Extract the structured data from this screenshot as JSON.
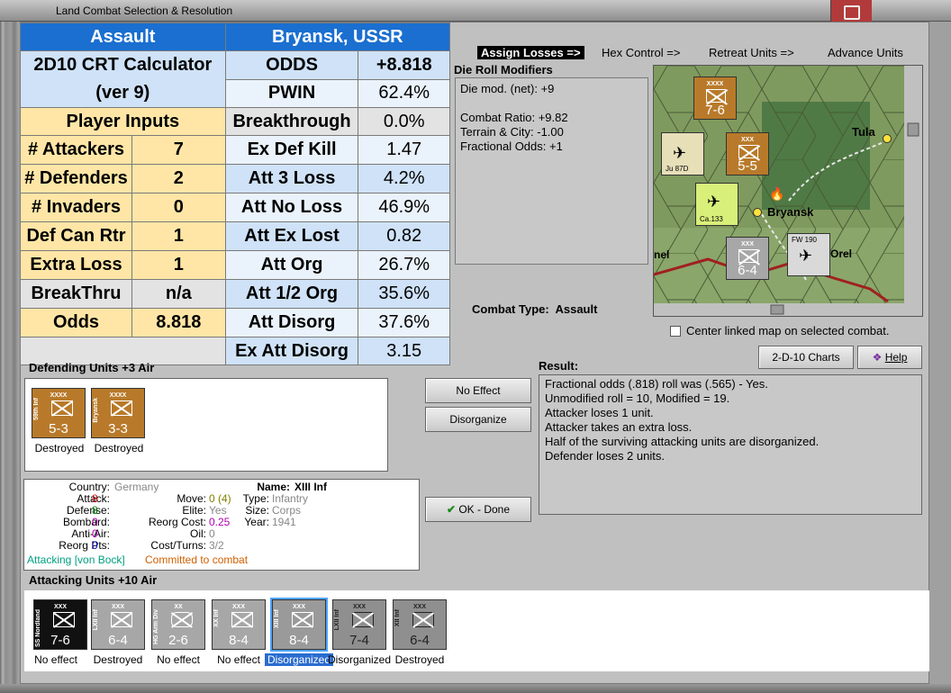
{
  "window": {
    "title": "Land Combat Selection & Resolution"
  },
  "calculator": {
    "header_left": "Assault",
    "header_right": "Bryansk, USSR",
    "title_line1": "2D10 CRT Calculator",
    "title_line2": "(ver 9)",
    "player_inputs": "Player Inputs",
    "inputs": [
      {
        "label": "# Attackers",
        "value": "7"
      },
      {
        "label": "# Defenders",
        "value": "2"
      },
      {
        "label": "# Invaders",
        "value": "0"
      },
      {
        "label": "Def Can Rtr",
        "value": "1"
      },
      {
        "label": "Extra Loss",
        "value": "1"
      },
      {
        "label": "BreakThru",
        "value": "n/a"
      },
      {
        "label": "Odds",
        "value": "8.818"
      }
    ],
    "results": [
      {
        "label": "ODDS",
        "value": "+8.818"
      },
      {
        "label": "PWIN",
        "value": "62.4%"
      },
      {
        "label": "Breakthrough",
        "value": "0.0%"
      },
      {
        "label": "Ex Def Kill",
        "value": "1.47"
      },
      {
        "label": "Att 3 Loss",
        "value": "4.2%"
      },
      {
        "label": "Att No Loss",
        "value": "46.9%"
      },
      {
        "label": "Att Ex Lost",
        "value": "0.82"
      },
      {
        "label": "Att Org",
        "value": "26.7%"
      },
      {
        "label": "Att 1/2 Org",
        "value": "35.6%"
      },
      {
        "label": "Att Disorg",
        "value": "37.6%"
      },
      {
        "label": "Ex Att Disorg",
        "value": "3.15"
      }
    ]
  },
  "toolbar": {
    "assign": "Assign Losses =>",
    "hex": "Hex Control =>",
    "retreat": "Retreat Units =>",
    "advance": "Advance Units"
  },
  "die_roll": {
    "title": "Die Roll Modifiers",
    "lines": [
      "Die mod. (net): +9",
      "",
      "Combat Ratio: +9.82",
      "Terrain & City: -1.00",
      "Fractional Odds: +1"
    ]
  },
  "map": {
    "city1": "Tula",
    "city2": "Bryansk",
    "city3": "Orel",
    "city4": "nel",
    "units": [
      {
        "str": "7-6",
        "top": "XXXX"
      },
      {
        "str": "5-5",
        "top": "XXX"
      },
      {
        "str": "6-4",
        "top": "XXX"
      }
    ],
    "air1": "Ju 87D",
    "air2": "Ca.133",
    "air3": "FW 190"
  },
  "combat_type": {
    "label": "Combat Type:",
    "value": "Assault"
  },
  "center_linked": "Center linked map on selected combat.",
  "buttons": {
    "charts": "2-D-10 Charts",
    "help": "Help",
    "no_effect": "No Effect",
    "disorganize": "Disorganize",
    "ok": "OK - Done"
  },
  "defending": {
    "title": "Defending Units +3 Air",
    "units": [
      {
        "str": "5-3",
        "top": "XXXX",
        "side": "59th Inf",
        "status": "Destroyed"
      },
      {
        "str": "3-3",
        "top": "XXXX",
        "side": "Bryansk",
        "status": "Destroyed"
      }
    ]
  },
  "result": {
    "title": "Result:",
    "lines": [
      "Fractional odds (.818) roll was (.565)  - Yes.",
      "Unmodified roll = 10, Modified = 19.",
      "Attacker loses 1 unit.",
      "Attacker takes an extra loss.",
      "Half of the surviving attacking units are disorganized.",
      "Defender loses 2 units."
    ]
  },
  "info": {
    "country_l": "Country:",
    "country": "Germany",
    "attack_l": "Attack:",
    "attack": "8",
    "defense_l": "Defense:",
    "defense": "8",
    "bombard_l": "Bombard:",
    "bombard": "0",
    "antiair_l": "Anti-Air:",
    "antiair": "0",
    "reorg_l": "Reorg Pts:",
    "reorg": "0",
    "name_l": "Name:",
    "name": "XIII Inf",
    "move_l": "Move:",
    "move": "0 (4)",
    "elite_l": "Elite:",
    "elite": "Yes",
    "reorgcost_l": "Reorg Cost:",
    "reorgcost": "0.25",
    "oil_l": "Oil:",
    "oil": "0",
    "costturns_l": "Cost/Turns:",
    "costturns": "3/2",
    "type_l": "Type:",
    "type": "Infantry",
    "size_l": "Size:",
    "size": "Corps",
    "year_l": "Year:",
    "year": "1941",
    "attacking": "Attacking [von Bock]",
    "committed": "Committed to combat"
  },
  "attacking": {
    "title": "Attacking Units +10 Air",
    "units": [
      {
        "str": "7-6",
        "top": "XXX",
        "side": "SS Nordland",
        "status": "No effect"
      },
      {
        "str": "6-4",
        "top": "XXX",
        "side": "LXII Inf",
        "status": "Destroyed"
      },
      {
        "str": "2-6",
        "top": "XX",
        "side": "HG Arm Div",
        "status": "No effect"
      },
      {
        "str": "8-4",
        "top": "XXX",
        "side": "XX Inf",
        "status": "No effect"
      },
      {
        "str": "8-4",
        "top": "XXX",
        "side": "XIII Inf",
        "status": "Disorganized"
      },
      {
        "str": "7-4",
        "top": "XXX",
        "side": "LXII Inf",
        "status": "Disorganized"
      },
      {
        "str": "6-4",
        "top": "XXX",
        "side": "XII Inf",
        "status": "Destroyed"
      }
    ]
  }
}
